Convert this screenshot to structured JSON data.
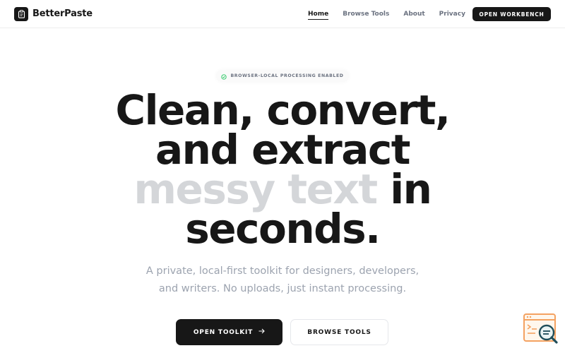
{
  "header": {
    "brand_name": "BetterPaste",
    "brand_icon": "clipboard-icon",
    "nav": [
      {
        "label": "Home",
        "active": true
      },
      {
        "label": "Browse Tools",
        "active": false
      },
      {
        "label": "About",
        "active": false
      },
      {
        "label": "Privacy",
        "active": false
      }
    ],
    "cta_label": "OPEN WORKBENCH"
  },
  "hero": {
    "badge_icon": "circle-check-icon",
    "badge_text": "BROWSER-LOCAL PROCESSING ENABLED",
    "title_line1": "Clean, convert,",
    "title_line2": "and extract",
    "title_muted": "messy text",
    "title_in": " in",
    "title_line4": "seconds.",
    "subtitle_line1": "A private, local-first toolkit for designers, developers,",
    "subtitle_line2": "and writers. No uploads, just instant processing.",
    "primary_label": "OPEN TOOLKIT",
    "primary_icon": "arrow-right-icon",
    "secondary_label": "BROWSE TOOLS"
  },
  "widget": {
    "icon": "help-search-icon"
  },
  "colors": {
    "text": "#171717",
    "muted_title": "#d4d6d9",
    "subtitle": "#9ca3af",
    "badge_icon": "#22c55e",
    "widget_accent": "#f4a261",
    "widget_dark": "#1f4e5a"
  }
}
